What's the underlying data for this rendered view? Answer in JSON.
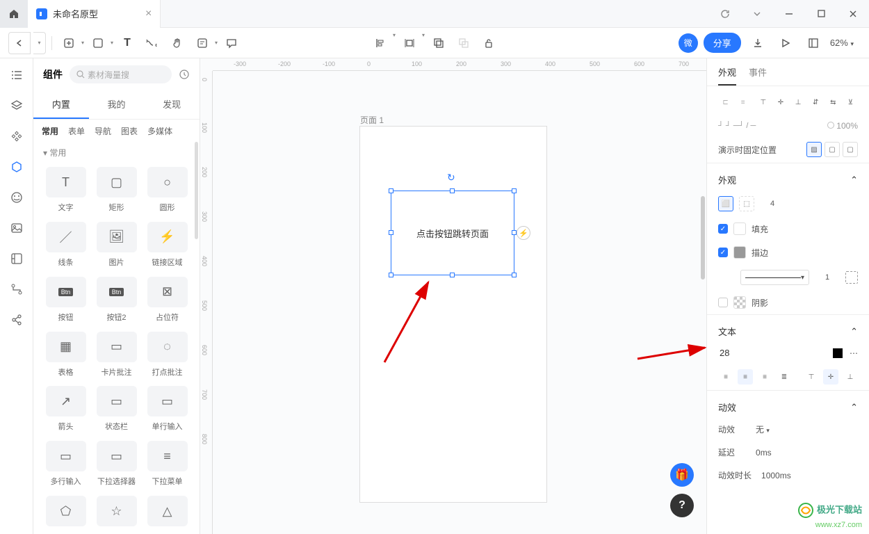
{
  "titlebar": {
    "tab_name": "未命名原型"
  },
  "toolbar": {
    "micro": "微",
    "share": "分享",
    "zoom": "62%"
  },
  "left_panel": {
    "title": "组件",
    "search_placeholder": "素材海量搜",
    "source_tabs": [
      "内置",
      "我的",
      "发现"
    ],
    "category_tabs": [
      "常用",
      "表单",
      "导航",
      "图表",
      "多媒体"
    ],
    "section": "常用",
    "components": [
      {
        "label": "文字",
        "glyph": "T"
      },
      {
        "label": "矩形",
        "glyph": "▢"
      },
      {
        "label": "圆形",
        "glyph": "○"
      },
      {
        "label": "线条",
        "glyph": "／"
      },
      {
        "label": "图片",
        "glyph": "🖼"
      },
      {
        "label": "链接区域",
        "glyph": "⚡"
      },
      {
        "label": "按钮",
        "glyph": "Btn"
      },
      {
        "label": "按钮2",
        "glyph": "Btn"
      },
      {
        "label": "占位符",
        "glyph": "⊠"
      },
      {
        "label": "表格",
        "glyph": "▦"
      },
      {
        "label": "卡片批注",
        "glyph": "▭"
      },
      {
        "label": "打点批注",
        "glyph": "◌"
      },
      {
        "label": "箭头",
        "glyph": "↗"
      },
      {
        "label": "状态栏",
        "glyph": "▭"
      },
      {
        "label": "单行输入",
        "glyph": "▭"
      },
      {
        "label": "多行输入",
        "glyph": "▭"
      },
      {
        "label": "下拉选择器",
        "glyph": "▭"
      },
      {
        "label": "下拉菜单",
        "glyph": "≡"
      }
    ]
  },
  "canvas": {
    "page_name": "页面 1",
    "selected_text": "点击按钮跳转页面",
    "ruler_h": [
      "-300",
      "-200",
      "-100",
      "0",
      "100",
      "200",
      "300",
      "400",
      "500",
      "600",
      "700"
    ],
    "ruler_v": [
      "0",
      "100",
      "200",
      "300",
      "400",
      "500",
      "600",
      "700",
      "800"
    ]
  },
  "right_panel": {
    "tabs": [
      "外观",
      "事件"
    ],
    "fixed_position_label": "演示时固定位置",
    "appearance_title": "外观",
    "radius_value": "4",
    "fill_label": "填充",
    "stroke_label": "描边",
    "stroke_width": "1",
    "shadow_label": "阴影",
    "text_title": "文本",
    "font_size": "28",
    "animation_title": "动效",
    "anim_label": "动效",
    "anim_value": "无",
    "delay_label": "延迟",
    "delay_value": "0ms",
    "duration_label": "动效时长",
    "duration_value": "1000ms",
    "percent_100": "100%"
  },
  "watermark": {
    "title": "极光下载站",
    "url": "www.xz7.com"
  }
}
